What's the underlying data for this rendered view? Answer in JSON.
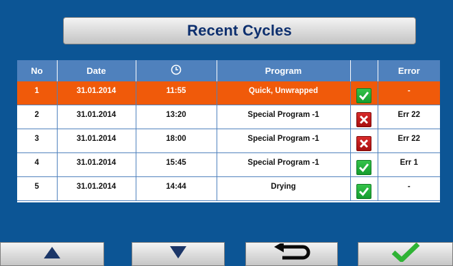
{
  "title": "Recent Cycles",
  "table": {
    "headers": {
      "no": "No",
      "date": "Date",
      "program": "Program",
      "error": "Error"
    },
    "time_icon": "clock-icon",
    "rows": [
      {
        "no": "1",
        "date": "31.01.2014",
        "time": "11:55",
        "program": "Quick, Unwrapped",
        "status": "ok",
        "error": "-"
      },
      {
        "no": "2",
        "date": "31.01.2014",
        "time": "13:20",
        "program": "Special Program -1",
        "status": "fail",
        "error": "Err 22"
      },
      {
        "no": "3",
        "date": "31.01.2014",
        "time": "18:00",
        "program": "Special Program -1",
        "status": "fail",
        "error": "Err 22"
      },
      {
        "no": "4",
        "date": "31.01.2014",
        "time": "15:45",
        "program": "Special Program -1",
        "status": "ok",
        "error": "Err 1"
      },
      {
        "no": "5",
        "date": "31.01.2014",
        "time": "14:44",
        "program": "Drying",
        "status": "ok",
        "error": "-"
      }
    ],
    "selected_row": 0
  },
  "buttons": [
    {
      "name": "scroll-up-button",
      "icon": "triangle-up-icon"
    },
    {
      "name": "scroll-down-button",
      "icon": "triangle-down-icon"
    },
    {
      "name": "back-button",
      "icon": "return-arrow-icon"
    },
    {
      "name": "confirm-button",
      "icon": "checkmark-icon"
    }
  ],
  "colors": {
    "background": "#0c5595",
    "header": "#4f81bd",
    "selected_row": "#f05a0a",
    "status_ok": "#1fa83a",
    "status_fail": "#c41a1a",
    "title_text": "#0d2f6e"
  }
}
